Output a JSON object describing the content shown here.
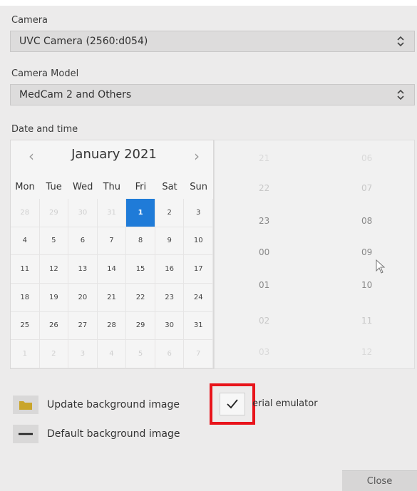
{
  "camera": {
    "label": "Camera",
    "value": "UVC Camera (2560:d054)"
  },
  "camera_model": {
    "label": "Camera Model",
    "value": "MedCam 2 and Others"
  },
  "datetime": {
    "label": "Date and time",
    "month": "January 2021",
    "prev": "‹",
    "next": "›",
    "weekdays": [
      "Mon",
      "Tue",
      "Wed",
      "Thu",
      "Fri",
      "Sat",
      "Sun"
    ],
    "days": [
      [
        "28",
        "29",
        "30",
        "31",
        "1",
        "2",
        "3"
      ],
      [
        "4",
        "5",
        "6",
        "7",
        "8",
        "9",
        "10"
      ],
      [
        "11",
        "12",
        "13",
        "14",
        "15",
        "16",
        "17"
      ],
      [
        "18",
        "19",
        "20",
        "21",
        "22",
        "23",
        "24"
      ],
      [
        "25",
        "26",
        "27",
        "28",
        "29",
        "30",
        "31"
      ],
      [
        "1",
        "2",
        "3",
        "4",
        "5",
        "6",
        "7"
      ]
    ],
    "selected": "1",
    "hours": [
      "21",
      "22",
      "23",
      "00",
      "01",
      "02",
      "03"
    ],
    "minutes": [
      "06",
      "07",
      "08",
      "09",
      "10",
      "11",
      "12"
    ]
  },
  "update_bg": {
    "label": "Update background image"
  },
  "default_bg": {
    "label": "Default background image"
  },
  "serial_emulator": {
    "label": "erial emulator",
    "checked": true
  },
  "close": {
    "label": "Close"
  },
  "colors": {
    "accent": "#1f7bd8",
    "highlight": "#e8141b"
  }
}
